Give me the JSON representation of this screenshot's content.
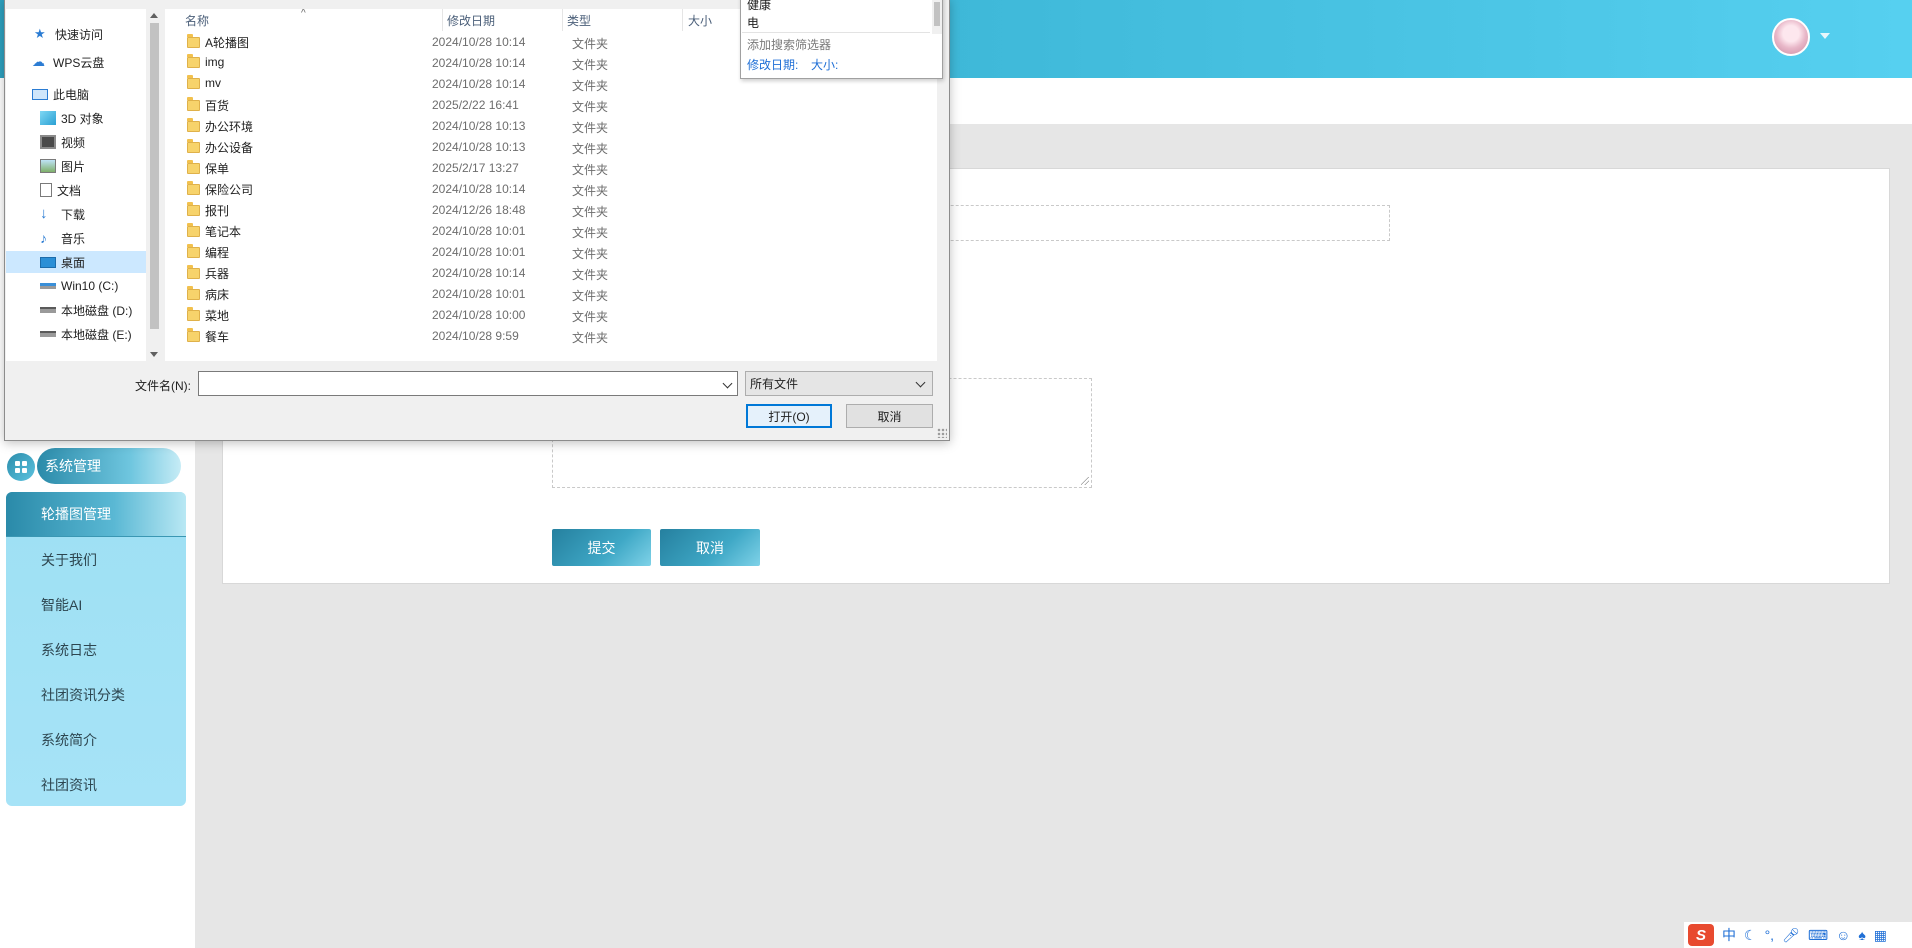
{
  "web": {
    "sidebar": {
      "section_label": "系统管理",
      "items": [
        {
          "label": "轮播图管理",
          "active": true
        },
        {
          "label": "关于我们",
          "active": false
        },
        {
          "label": "智能AI",
          "active": false
        },
        {
          "label": "系统日志",
          "active": false
        },
        {
          "label": "社团资讯分类",
          "active": false
        },
        {
          "label": "系统简介",
          "active": false
        },
        {
          "label": "社团资讯",
          "active": false
        }
      ]
    },
    "form": {
      "submit_label": "提交",
      "cancel_label": "取消"
    },
    "avatar_icon": "user-avatar",
    "brand_colors": {
      "header_start": "#2ea1bf",
      "header_end": "#56d0f0",
      "menu_bg": "#a6e3f7"
    }
  },
  "dialog": {
    "nav": [
      {
        "label": "快速访问",
        "icon": "star-icon"
      },
      {
        "label": "WPS云盘",
        "icon": "cloud-icon"
      },
      {
        "label": "此电脑",
        "icon": "computer-icon"
      },
      {
        "label": "3D 对象",
        "icon": "cube-icon"
      },
      {
        "label": "视频",
        "icon": "video-icon"
      },
      {
        "label": "图片",
        "icon": "picture-icon"
      },
      {
        "label": "文档",
        "icon": "document-icon"
      },
      {
        "label": "下载",
        "icon": "download-icon"
      },
      {
        "label": "音乐",
        "icon": "music-icon"
      },
      {
        "label": "桌面",
        "icon": "desktop-icon",
        "selected": true
      },
      {
        "label": "Win10 (C:)",
        "icon": "drive-icon"
      },
      {
        "label": "本地磁盘 (D:)",
        "icon": "drive-icon"
      },
      {
        "label": "本地磁盘 (E:)",
        "icon": "drive-icon"
      }
    ],
    "columns": [
      "名称",
      "修改日期",
      "类型",
      "大小"
    ],
    "files": [
      {
        "name": "A轮播图",
        "date": "2024/10/28 10:14",
        "type": "文件夹"
      },
      {
        "name": "img",
        "date": "2024/10/28 10:14",
        "type": "文件夹"
      },
      {
        "name": "mv",
        "date": "2024/10/28 10:14",
        "type": "文件夹"
      },
      {
        "name": "百货",
        "date": "2025/2/22 16:41",
        "type": "文件夹"
      },
      {
        "name": "办公环境",
        "date": "2024/10/28 10:13",
        "type": "文件夹"
      },
      {
        "name": "办公设备",
        "date": "2024/10/28 10:13",
        "type": "文件夹"
      },
      {
        "name": "保单",
        "date": "2025/2/17 13:27",
        "type": "文件夹"
      },
      {
        "name": "保险公司",
        "date": "2024/10/28 10:14",
        "type": "文件夹"
      },
      {
        "name": "报刊",
        "date": "2024/12/26 18:48",
        "type": "文件夹"
      },
      {
        "name": "笔记本",
        "date": "2024/10/28 10:01",
        "type": "文件夹"
      },
      {
        "name": "编程",
        "date": "2024/10/28 10:01",
        "type": "文件夹"
      },
      {
        "name": "兵器",
        "date": "2024/10/28 10:14",
        "type": "文件夹"
      },
      {
        "name": "病床",
        "date": "2024/10/28 10:01",
        "type": "文件夹"
      },
      {
        "name": "菜地",
        "date": "2024/10/28 10:00",
        "type": "文件夹"
      },
      {
        "name": "餐车",
        "date": "2024/10/28 9:59",
        "type": "文件夹"
      }
    ],
    "filename_label": "文件名(N):",
    "filename_value": "",
    "filetype_value": "所有文件",
    "open_label": "打开(O)",
    "cancel_label": "取消",
    "search_popup": {
      "items": [
        "健康",
        "电"
      ],
      "add_filter": "添加搜索筛选器",
      "filters": [
        "修改日期:",
        "大小:"
      ]
    }
  },
  "ime": {
    "mode": "中"
  }
}
